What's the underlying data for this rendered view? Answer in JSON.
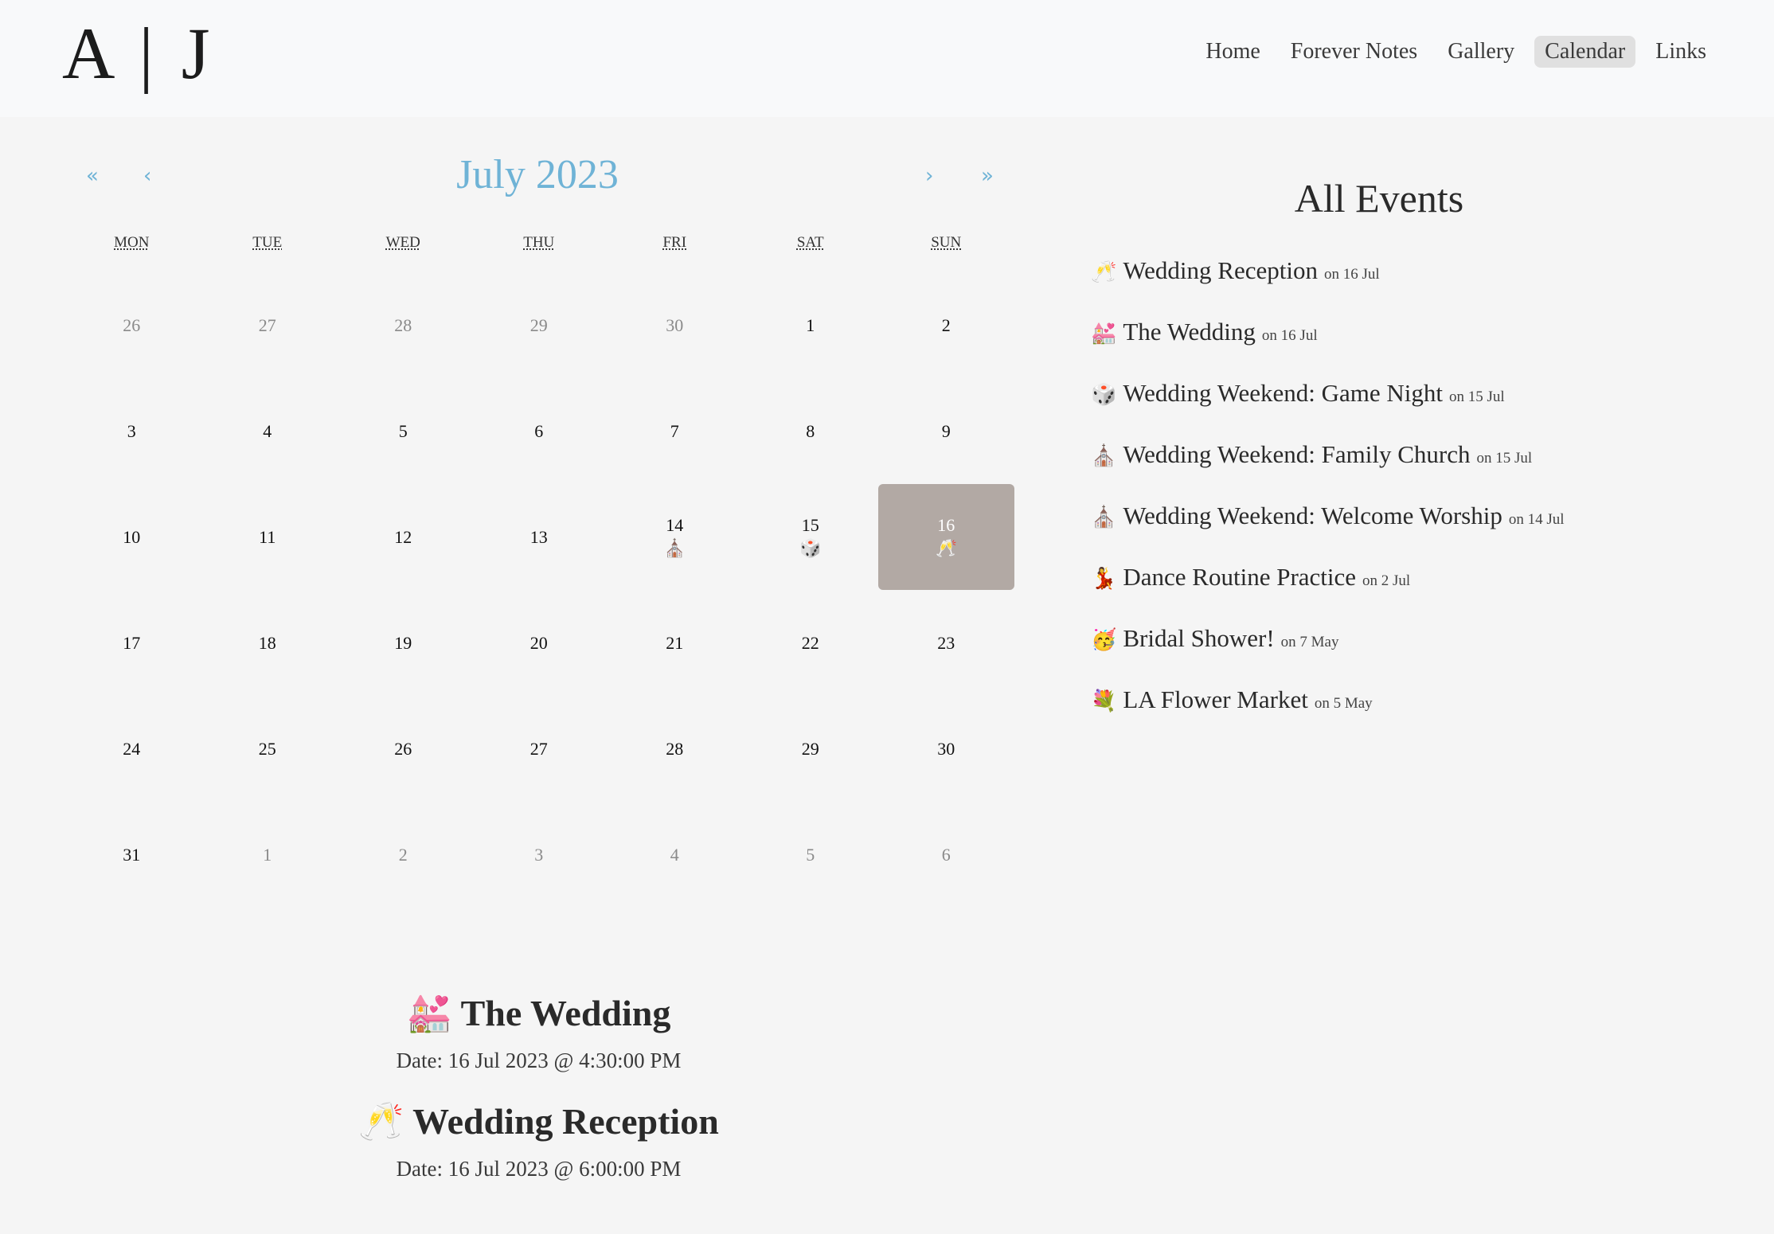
{
  "header": {
    "logo": "A | J",
    "nav": [
      {
        "label": "Home",
        "active": false
      },
      {
        "label": "Forever Notes",
        "active": false
      },
      {
        "label": "Gallery",
        "active": false
      },
      {
        "label": "Calendar",
        "active": true
      },
      {
        "label": "Links",
        "active": false
      }
    ]
  },
  "calendar": {
    "month_label": "July 2023",
    "nav": {
      "prev_year": "«",
      "prev_month": "‹",
      "next_month": "›",
      "next_year": "»"
    },
    "weekdays": [
      "MON",
      "TUE",
      "WED",
      "THU",
      "FRI",
      "SAT",
      "SUN"
    ],
    "days": [
      {
        "n": "26",
        "other": true
      },
      {
        "n": "27",
        "other": true
      },
      {
        "n": "28",
        "other": true
      },
      {
        "n": "29",
        "other": true
      },
      {
        "n": "30",
        "other": true
      },
      {
        "n": "1"
      },
      {
        "n": "2"
      },
      {
        "n": "3"
      },
      {
        "n": "4"
      },
      {
        "n": "5"
      },
      {
        "n": "6"
      },
      {
        "n": "7"
      },
      {
        "n": "8"
      },
      {
        "n": "9"
      },
      {
        "n": "10"
      },
      {
        "n": "11"
      },
      {
        "n": "12"
      },
      {
        "n": "13"
      },
      {
        "n": "14",
        "icon": "⛪"
      },
      {
        "n": "15",
        "icon": "🎲"
      },
      {
        "n": "16",
        "icon": "🥂",
        "selected": true
      },
      {
        "n": "17"
      },
      {
        "n": "18"
      },
      {
        "n": "19"
      },
      {
        "n": "20"
      },
      {
        "n": "21"
      },
      {
        "n": "22"
      },
      {
        "n": "23"
      },
      {
        "n": "24"
      },
      {
        "n": "25"
      },
      {
        "n": "26"
      },
      {
        "n": "27"
      },
      {
        "n": "28"
      },
      {
        "n": "29"
      },
      {
        "n": "30"
      },
      {
        "n": "31"
      },
      {
        "n": "1",
        "other": true
      },
      {
        "n": "2",
        "other": true
      },
      {
        "n": "3",
        "other": true
      },
      {
        "n": "4",
        "other": true
      },
      {
        "n": "5",
        "other": true
      },
      {
        "n": "6",
        "other": true
      }
    ]
  },
  "selected_day_events": [
    {
      "icon": "💒",
      "title": "The Wedding",
      "date": "Date: 16 Jul 2023 @ 4:30:00 PM"
    },
    {
      "icon": "🥂",
      "title": "Wedding Reception",
      "date": "Date: 16 Jul 2023 @ 6:00:00 PM"
    }
  ],
  "all_events": {
    "heading": "All Events",
    "items": [
      {
        "icon": "🥂",
        "name": "Wedding Reception",
        "on": "on 16 Jul"
      },
      {
        "icon": "💒",
        "name": "The Wedding",
        "on": "on 16 Jul"
      },
      {
        "icon": "🎲",
        "name": "Wedding Weekend: Game Night",
        "on": "on 15 Jul"
      },
      {
        "icon": "⛪",
        "name": "Wedding Weekend: Family Church",
        "on": "on 15 Jul"
      },
      {
        "icon": "⛪",
        "name": "Wedding Weekend: Welcome Worship",
        "on": "on 14 Jul"
      },
      {
        "icon": "💃",
        "name": "Dance Routine Practice",
        "on": "on 2 Jul"
      },
      {
        "icon": "🥳",
        "name": "Bridal Shower!",
        "on": "on 7 May"
      },
      {
        "icon": "💐",
        "name": "LA Flower Market",
        "on": "on 5 May"
      }
    ]
  }
}
